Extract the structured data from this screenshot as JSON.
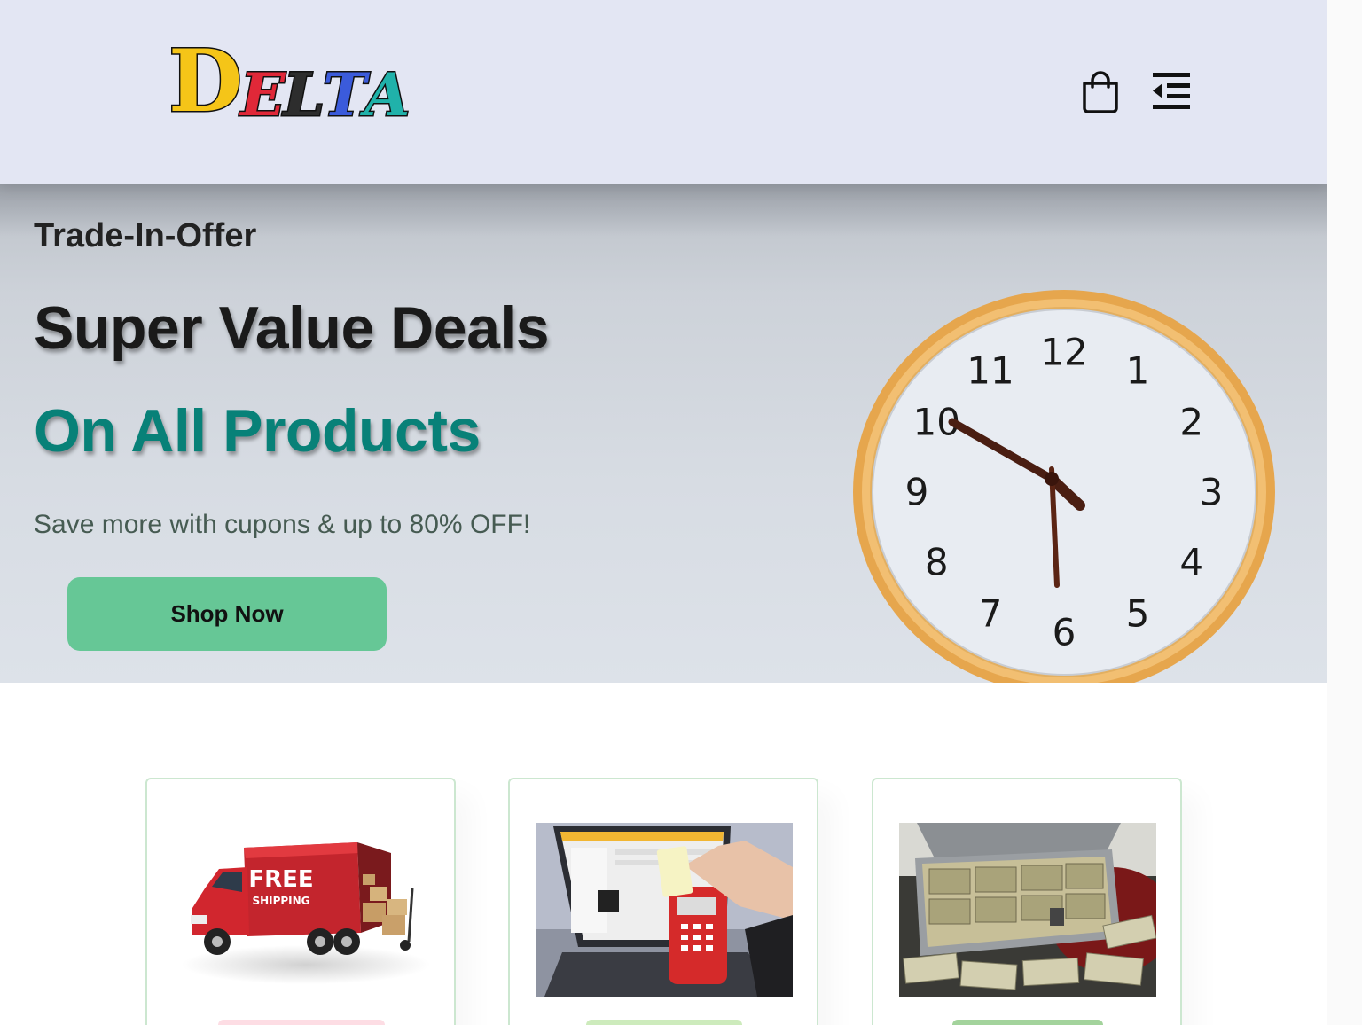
{
  "header": {
    "logo_letters": [
      "D",
      "E",
      "L",
      "T",
      "A"
    ],
    "logo_colors": [
      "#f5c518",
      "#e02838",
      "#2d2d2d",
      "#3b5bdb",
      "#20b2aa"
    ],
    "icons": [
      "shopping-bag-icon",
      "menu-indent-icon"
    ]
  },
  "hero": {
    "kicker": "Trade-In-Offer",
    "title": "Super Value Deals",
    "subtitle": "On All Products",
    "description": "Save more with cupons & up to 80% OFF!",
    "button_label": "Shop Now",
    "accent_color": "#088178",
    "button_color": "#66c796",
    "clock": {
      "numbers": [
        "12",
        "1",
        "2",
        "3",
        "4",
        "5",
        "6",
        "7",
        "8",
        "9",
        "10",
        "11"
      ],
      "time_shown": "5:50"
    }
  },
  "features": {
    "cards": [
      {
        "image": "free-shipping-truck-image",
        "image_text_1": "FREE",
        "image_text_2": "SHIPPING",
        "badge_color": "#fddde4"
      },
      {
        "image": "online-payment-image",
        "badge_color": "#cdebbc"
      },
      {
        "image": "money-case-image",
        "badge_color": "#a3d39c"
      }
    ]
  }
}
